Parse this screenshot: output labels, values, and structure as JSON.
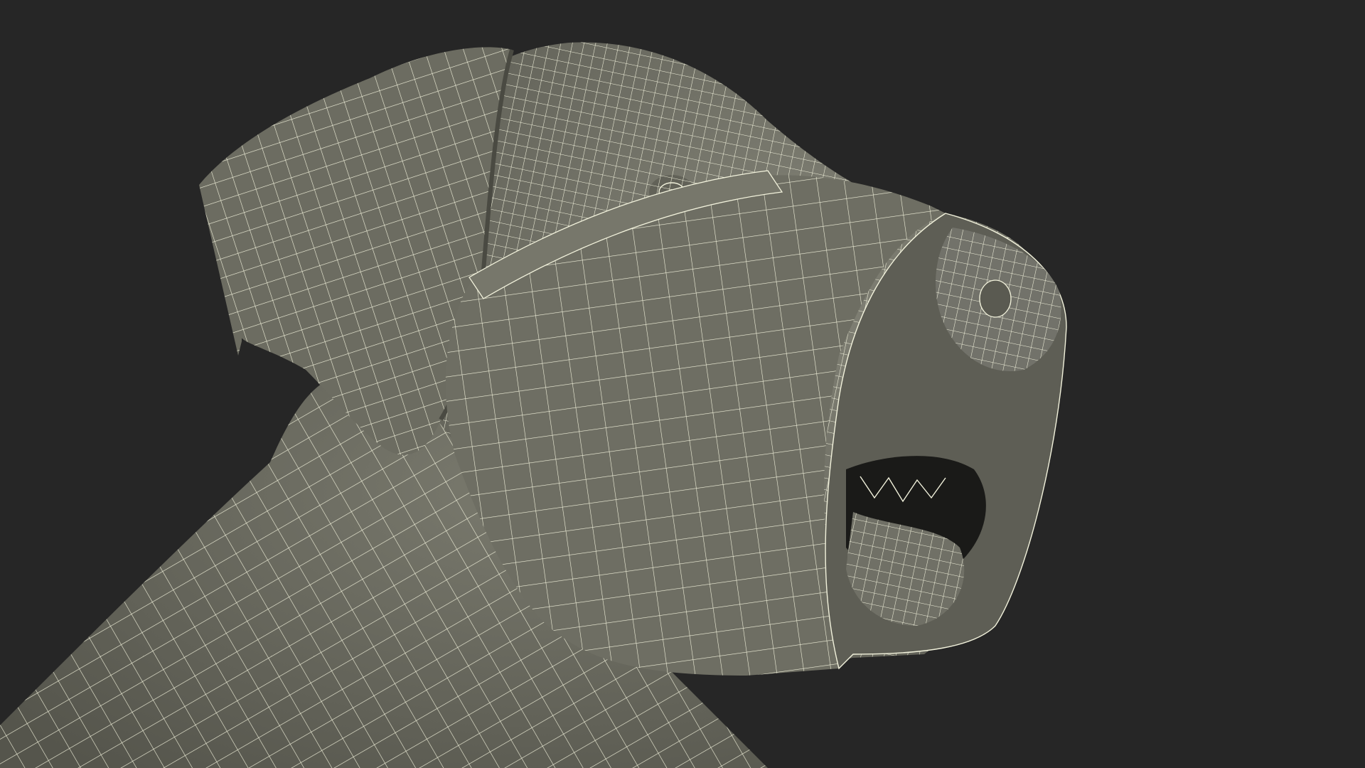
{
  "scene": {
    "subject": "wireframe-dog-head-with-muzzle",
    "background_color": "#262626",
    "surface_color": "#6e6e63",
    "surface_shadow_color": "#55554c",
    "surface_light_color": "#838377",
    "wire_color": "#f2f2dc",
    "mouth_interior_color": "#1a1a18"
  }
}
